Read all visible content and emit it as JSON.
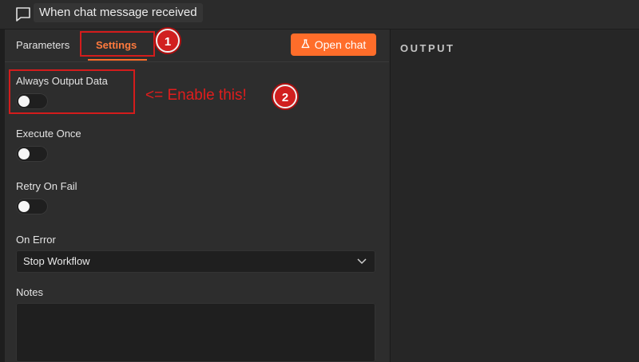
{
  "header": {
    "title": "When chat message received"
  },
  "tabs": [
    {
      "label": "Parameters"
    },
    {
      "label": "Settings"
    }
  ],
  "open_chat_label": "Open chat",
  "settings": {
    "always_output": {
      "label": "Always Output Data",
      "enabled": false
    },
    "execute_once": {
      "label": "Execute Once",
      "enabled": false
    },
    "retry_on_fail": {
      "label": "Retry On Fail",
      "enabled": false
    },
    "on_error": {
      "label": "On Error",
      "value": "Stop Workflow"
    },
    "notes": {
      "label": "Notes",
      "value": ""
    }
  },
  "output": {
    "label": "OUTPUT"
  },
  "annotations": {
    "badge1": "1",
    "badge2": "2",
    "note": "<= Enable this!",
    "color": "#d31c1c"
  },
  "colors": {
    "accent": "#ff6d2a",
    "background": "#2d2d2d"
  },
  "icons": {
    "chat": "chat-bubble-icon",
    "open_chat": "flask-icon",
    "dropdown": "chevron-down-icon"
  }
}
